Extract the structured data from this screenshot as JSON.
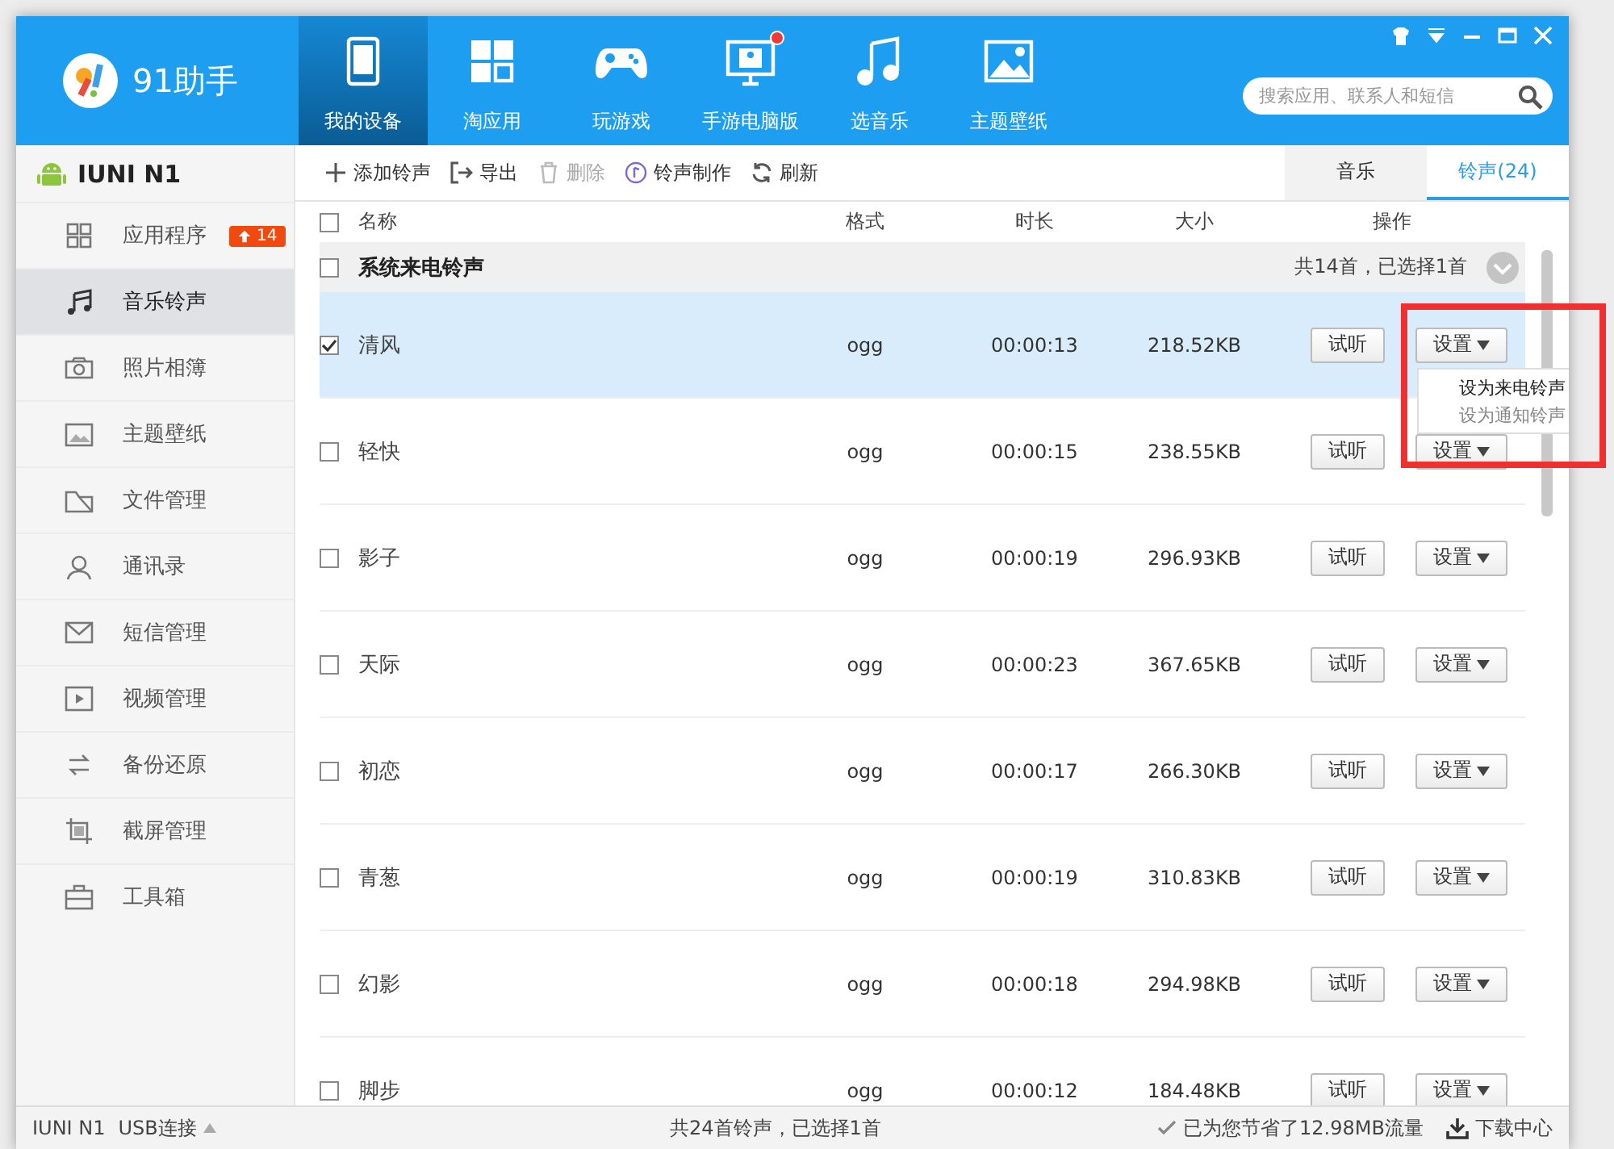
{
  "app": {
    "name": "91助手"
  },
  "window_controls": [
    {
      "kind": "skin"
    },
    {
      "kind": "menu"
    },
    {
      "kind": "minimize"
    },
    {
      "kind": "maximize"
    },
    {
      "kind": "close"
    }
  ],
  "nav": [
    {
      "label": "我的设备",
      "kind": "tablet",
      "selected": true,
      "badge": false
    },
    {
      "label": "淘应用",
      "kind": "apps",
      "selected": false,
      "badge": false
    },
    {
      "label": "玩游戏",
      "kind": "gamepad",
      "selected": false,
      "badge": false
    },
    {
      "label": "手游电脑版",
      "kind": "monitor",
      "selected": false,
      "badge": true
    },
    {
      "label": "选音乐",
      "kind": "music",
      "selected": false,
      "badge": false
    },
    {
      "label": "主题壁纸",
      "kind": "image",
      "selected": false,
      "badge": false
    }
  ],
  "search": {
    "placeholder": "搜索应用、联系人和短信"
  },
  "device": {
    "name": "IUNI N1"
  },
  "sidebar": {
    "items": [
      {
        "label": "应用程序",
        "kind": "grid",
        "selected": false,
        "badge": "14"
      },
      {
        "label": "音乐铃声",
        "kind": "music",
        "selected": true
      },
      {
        "label": "照片相簿",
        "kind": "camera",
        "selected": false
      },
      {
        "label": "主题壁纸",
        "kind": "image",
        "selected": false
      },
      {
        "label": "文件管理",
        "kind": "folder",
        "selected": false
      },
      {
        "label": "通讯录",
        "kind": "contact",
        "selected": false
      },
      {
        "label": "短信管理",
        "kind": "mail",
        "selected": false
      },
      {
        "label": "视频管理",
        "kind": "video",
        "selected": false
      },
      {
        "label": "备份还原",
        "kind": "sync",
        "selected": false
      },
      {
        "label": "截屏管理",
        "kind": "crop",
        "selected": false
      },
      {
        "label": "工具箱",
        "kind": "toolbox",
        "selected": false
      }
    ]
  },
  "toolbar": [
    {
      "label": "添加铃声",
      "kind": "add",
      "disabled": false
    },
    {
      "label": "导出",
      "kind": "export",
      "disabled": false
    },
    {
      "label": "删除",
      "kind": "delete",
      "disabled": true
    },
    {
      "label": "铃声制作",
      "kind": "make",
      "disabled": false
    },
    {
      "label": "刷新",
      "kind": "refresh",
      "disabled": false
    }
  ],
  "view_tabs": [
    {
      "label": "音乐",
      "selected": false
    },
    {
      "label": "铃声(24)",
      "selected": true
    }
  ],
  "table": {
    "columns": [
      "名称",
      "格式",
      "时长",
      "大小",
      "操作"
    ],
    "all_checked": false,
    "group": {
      "title": "系统来电铃声",
      "summary": "共14首，已选择1首",
      "checked": false
    },
    "rows": [
      {
        "name": "清风",
        "format": "ogg",
        "duration": "00:00:13",
        "size": "218.52KB",
        "checked": true,
        "selected": true,
        "actions": [
          "试听",
          "设置"
        ],
        "menu": [
          {
            "label": "设为来电铃声",
            "selected": true
          },
          {
            "label": "设为通知铃声",
            "selected": false
          }
        ]
      },
      {
        "name": "轻快",
        "format": "ogg",
        "duration": "00:00:15",
        "size": "238.55KB",
        "checked": false,
        "selected": false,
        "actions": [
          "试听",
          "设置"
        ]
      },
      {
        "name": "影子",
        "format": "ogg",
        "duration": "00:00:19",
        "size": "296.93KB",
        "checked": false,
        "selected": false,
        "actions": [
          "试听",
          "设置"
        ]
      },
      {
        "name": "天际",
        "format": "ogg",
        "duration": "00:00:23",
        "size": "367.65KB",
        "checked": false,
        "selected": false,
        "actions": [
          "试听",
          "设置"
        ]
      },
      {
        "name": "初恋",
        "format": "ogg",
        "duration": "00:00:17",
        "size": "266.30KB",
        "checked": false,
        "selected": false,
        "actions": [
          "试听",
          "设置"
        ]
      },
      {
        "name": "青葱",
        "format": "ogg",
        "duration": "00:00:19",
        "size": "310.83KB",
        "checked": false,
        "selected": false,
        "actions": [
          "试听",
          "设置"
        ]
      },
      {
        "name": "幻影",
        "format": "ogg",
        "duration": "00:00:18",
        "size": "294.98KB",
        "checked": false,
        "selected": false,
        "actions": [
          "试听",
          "设置"
        ]
      },
      {
        "name": "脚步",
        "format": "ogg",
        "duration": "00:00:12",
        "size": "184.48KB",
        "checked": false,
        "selected": false,
        "actions": [
          "试听",
          "设置"
        ]
      }
    ]
  },
  "annotations": [
    {
      "kind": "frame"
    }
  ],
  "status_bar": {
    "device": "IUNI N1",
    "connection": "USB连接",
    "summary": "共24首铃声，已选择1首",
    "saved": "已为您节省了12.98MB流量",
    "download": "下载中心"
  }
}
